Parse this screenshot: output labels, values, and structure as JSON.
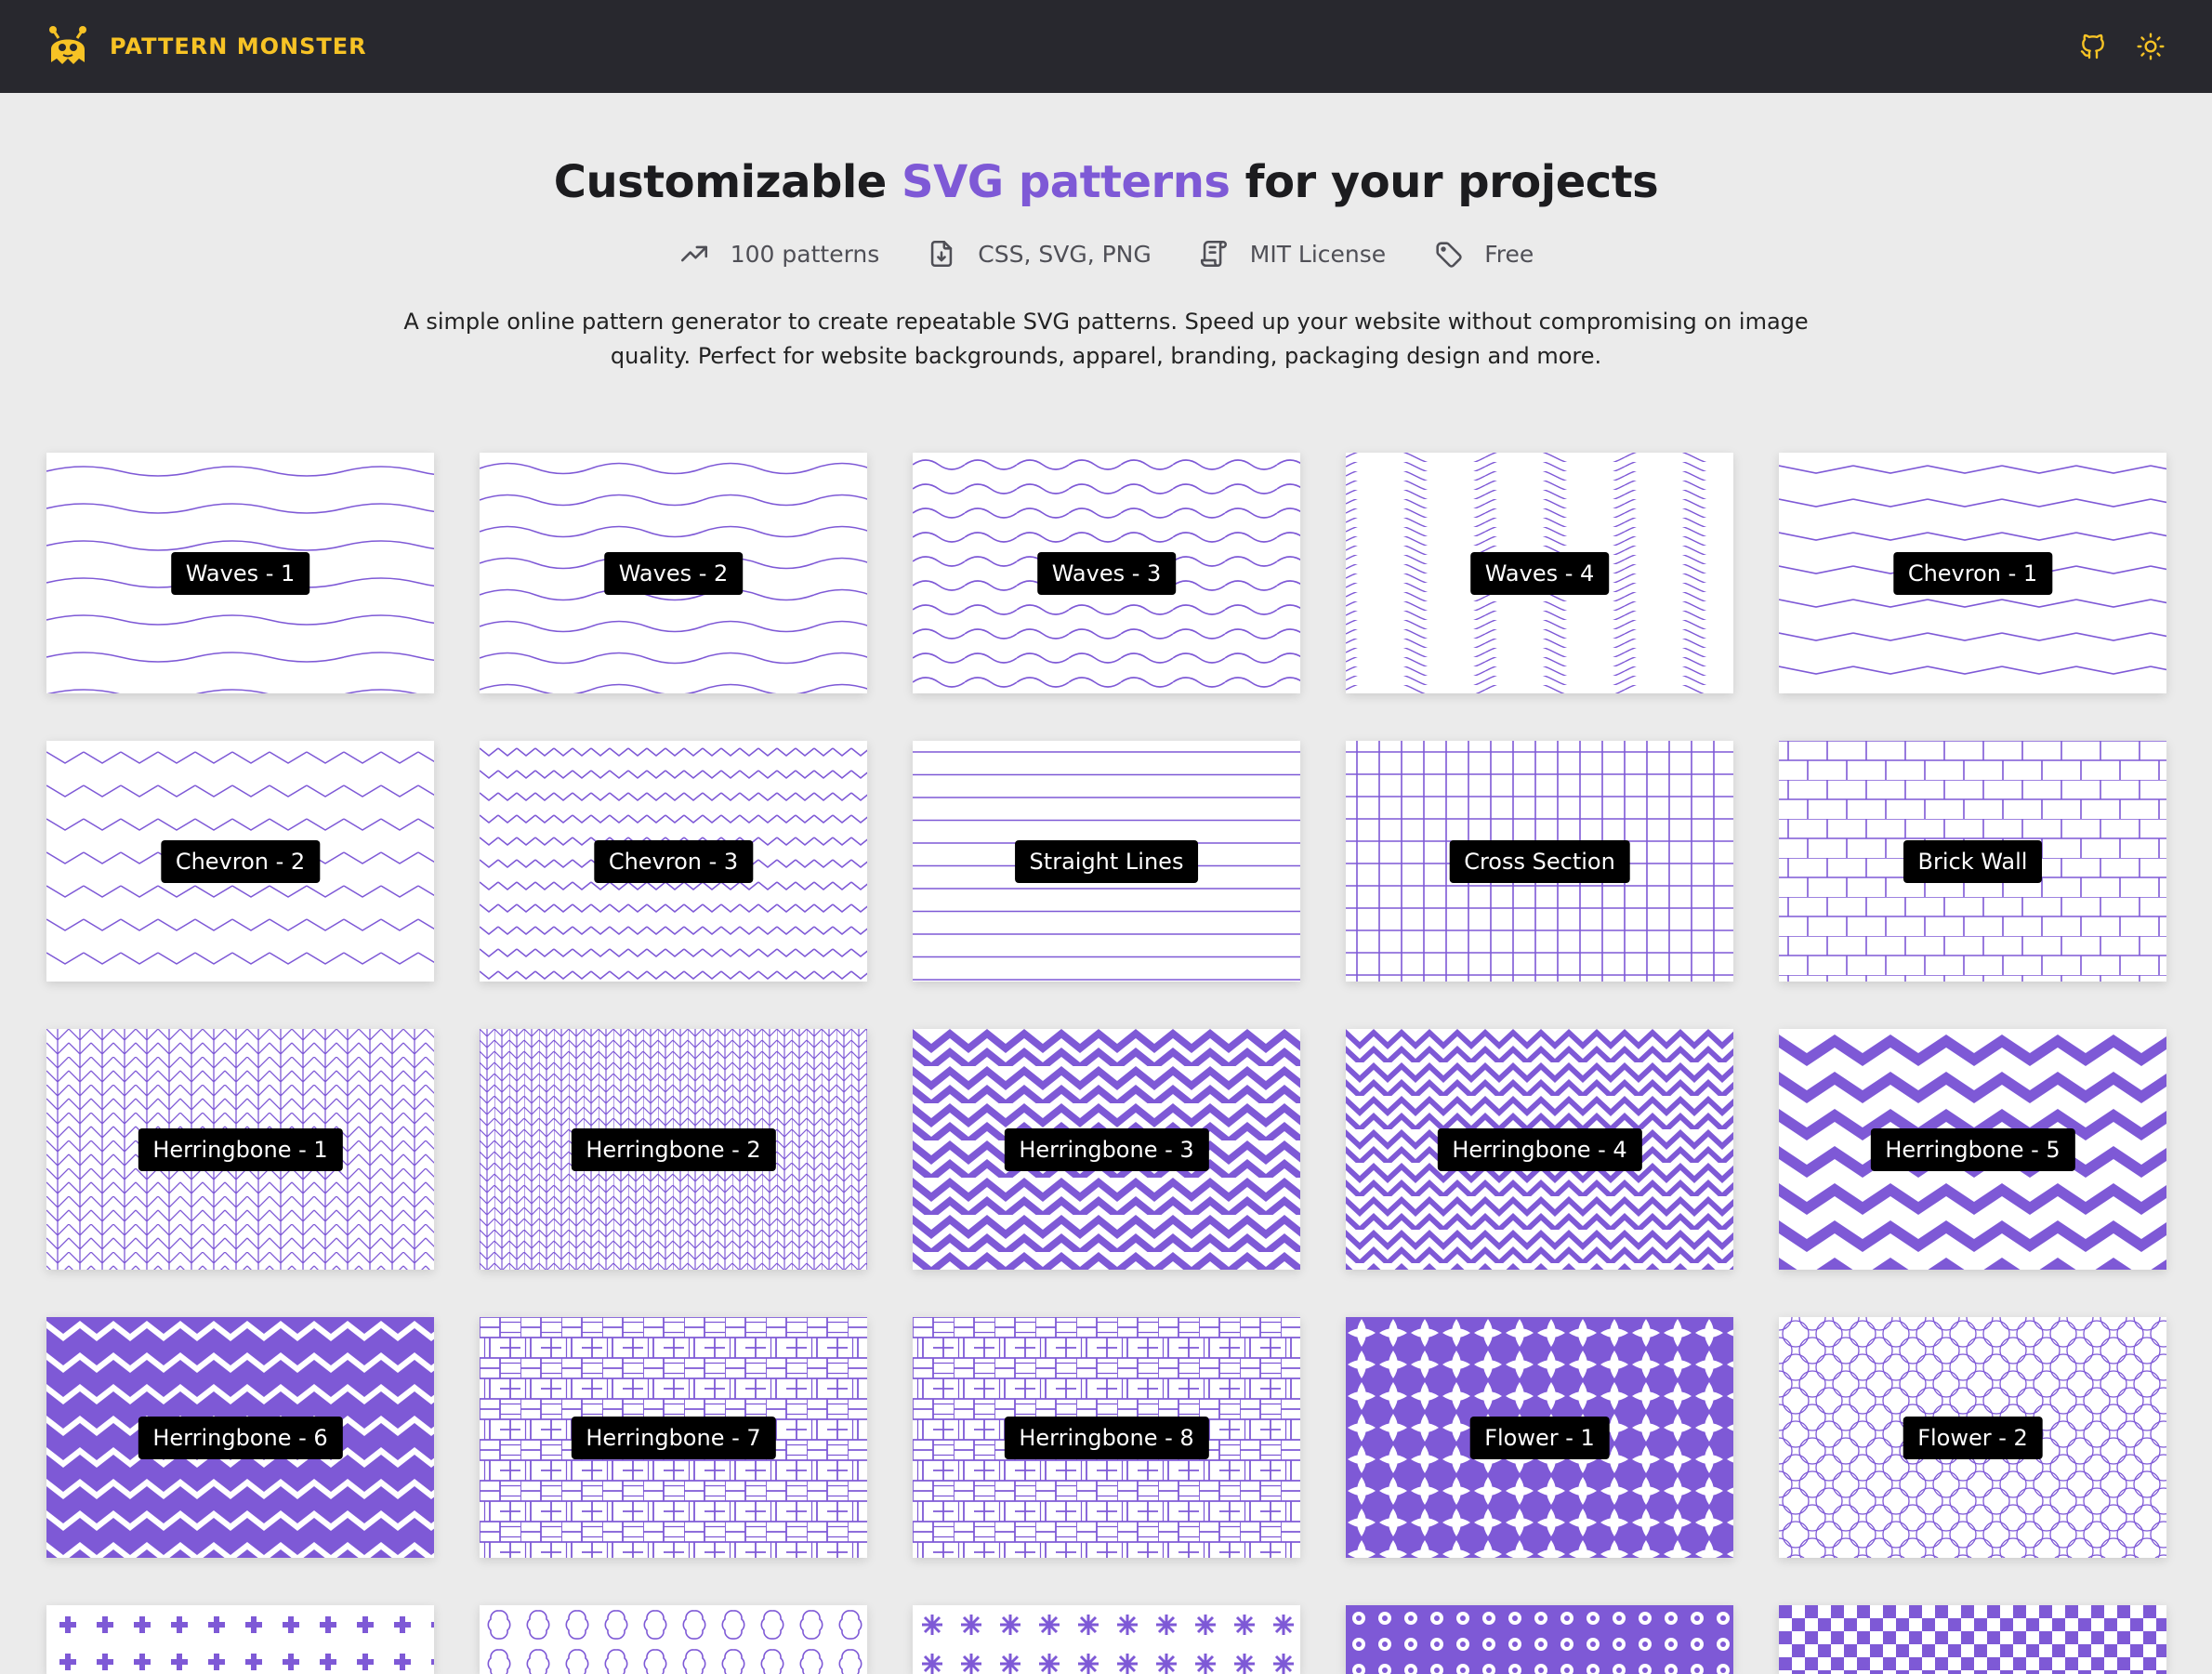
{
  "header": {
    "brand": "PATTERN MONSTER",
    "icons": {
      "github": "github-icon",
      "theme": "sun-icon"
    },
    "colors": {
      "bar": "#28282e",
      "brand": "#f7c325"
    }
  },
  "hero": {
    "title_pre": "Customizable ",
    "title_accent": "SVG patterns",
    "title_post": " for your projects",
    "features": [
      {
        "icon": "trending-up-icon",
        "label": "100 patterns"
      },
      {
        "icon": "file-download-icon",
        "label": "CSS, SVG, PNG"
      },
      {
        "icon": "license-icon",
        "label": "MIT License"
      },
      {
        "icon": "tag-icon",
        "label": "Free"
      }
    ],
    "description": "A simple online pattern generator to create repeatable SVG patterns. Speed up your website without compromising on image quality. Perfect for website backgrounds, apparel, branding, packaging design and more."
  },
  "theme": {
    "accent": "#7e59d6",
    "card_bg": "#ffffff",
    "page_bg": "#ebebeb"
  },
  "patterns": [
    {
      "name": "Waves - 1",
      "kind": "waves1"
    },
    {
      "name": "Waves - 2",
      "kind": "waves2"
    },
    {
      "name": "Waves - 3",
      "kind": "waves3"
    },
    {
      "name": "Waves - 4",
      "kind": "waves4"
    },
    {
      "name": "Chevron - 1",
      "kind": "chevron1"
    },
    {
      "name": "Chevron - 2",
      "kind": "chevron2"
    },
    {
      "name": "Chevron - 3",
      "kind": "chevron3"
    },
    {
      "name": "Straight Lines",
      "kind": "lines"
    },
    {
      "name": "Cross Section",
      "kind": "cross"
    },
    {
      "name": "Brick Wall",
      "kind": "brick"
    },
    {
      "name": "Herringbone - 1",
      "kind": "herring1"
    },
    {
      "name": "Herringbone - 2",
      "kind": "herring2"
    },
    {
      "name": "Herringbone - 3",
      "kind": "herring3"
    },
    {
      "name": "Herringbone - 4",
      "kind": "herring4"
    },
    {
      "name": "Herringbone - 5",
      "kind": "herring5"
    },
    {
      "name": "Herringbone - 6",
      "kind": "herring6"
    },
    {
      "name": "Herringbone - 7",
      "kind": "weave"
    },
    {
      "name": "Herringbone - 8",
      "kind": "weave"
    },
    {
      "name": "Flower - 1",
      "kind": "flower1"
    },
    {
      "name": "Flower - 2",
      "kind": "flower2"
    }
  ],
  "partial_patterns": [
    {
      "kind": "dots"
    },
    {
      "kind": "quatrefoil"
    },
    {
      "kind": "stars"
    },
    {
      "kind": "flowerdense"
    },
    {
      "kind": "checker"
    }
  ]
}
